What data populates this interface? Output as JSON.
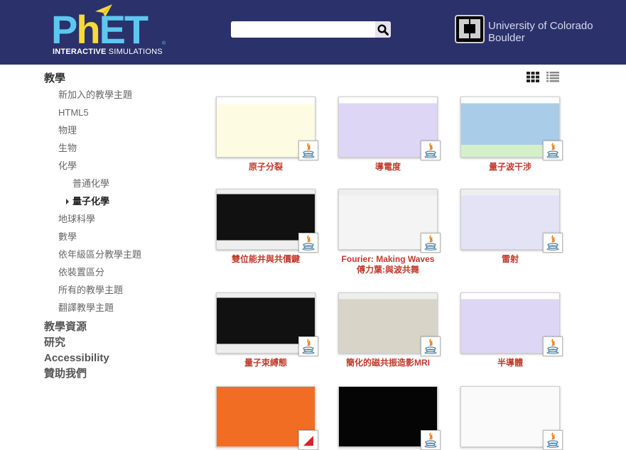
{
  "header": {
    "logo": {
      "main": "PhET",
      "sub_bold": "INTERACTIVE",
      "sub_rest": " SIMULATIONS",
      "registered": "®"
    },
    "search": {
      "value": "",
      "placeholder": "",
      "icon": "search-icon"
    },
    "university": {
      "line1": "University of Colorado",
      "line2": "Boulder"
    }
  },
  "colors": {
    "header_bg": "#2a316b",
    "logo_blue": "#5dc7f0",
    "logo_yellow": "#f8d936",
    "sim_title": "#c0392b"
  },
  "sidebar": {
    "teaching": "教學",
    "items": [
      {
        "label": "新加入的教學主題",
        "level": 1
      },
      {
        "label": "HTML5",
        "level": 1
      },
      {
        "label": "物理",
        "level": 1
      },
      {
        "label": "生物",
        "level": 1
      },
      {
        "label": "化學",
        "level": 1
      },
      {
        "label": "普通化學",
        "level": 2
      },
      {
        "label": "量子化學",
        "level": 2,
        "active": true
      },
      {
        "label": "地球科學",
        "level": 1
      },
      {
        "label": "數學",
        "level": 1
      },
      {
        "label": "依年級區分教學主題",
        "level": 1
      },
      {
        "label": "依裝置區分",
        "level": 1
      },
      {
        "label": "所有的教學主題",
        "level": 1
      },
      {
        "label": "翻譯教學主題",
        "level": 1
      }
    ],
    "bottom": [
      "教學資源",
      "研究",
      "Accessibility",
      "贊助我們"
    ]
  },
  "view_toggle": {
    "grid": "grid-view-icon",
    "list": "list-view-icon"
  },
  "simulations": [
    {
      "title": "原子分裂",
      "platform": "java"
    },
    {
      "title": "導電度",
      "platform": "java"
    },
    {
      "title": "量子波干涉",
      "platform": "java"
    },
    {
      "title": "雙位能井與共價鍵",
      "platform": "java"
    },
    {
      "title": "Fourier: Making Waves 傅力葉:與波共舞",
      "platform": "java"
    },
    {
      "title": "雷射",
      "platform": "java"
    },
    {
      "title": "量子束縛態",
      "platform": "java"
    },
    {
      "title": "簡化的磁共振造影MRI",
      "platform": "java"
    },
    {
      "title": "半導體",
      "platform": "java"
    },
    {
      "title": "",
      "platform": "flash"
    },
    {
      "title": "",
      "platform": "java"
    },
    {
      "title": "",
      "platform": "java"
    }
  ]
}
